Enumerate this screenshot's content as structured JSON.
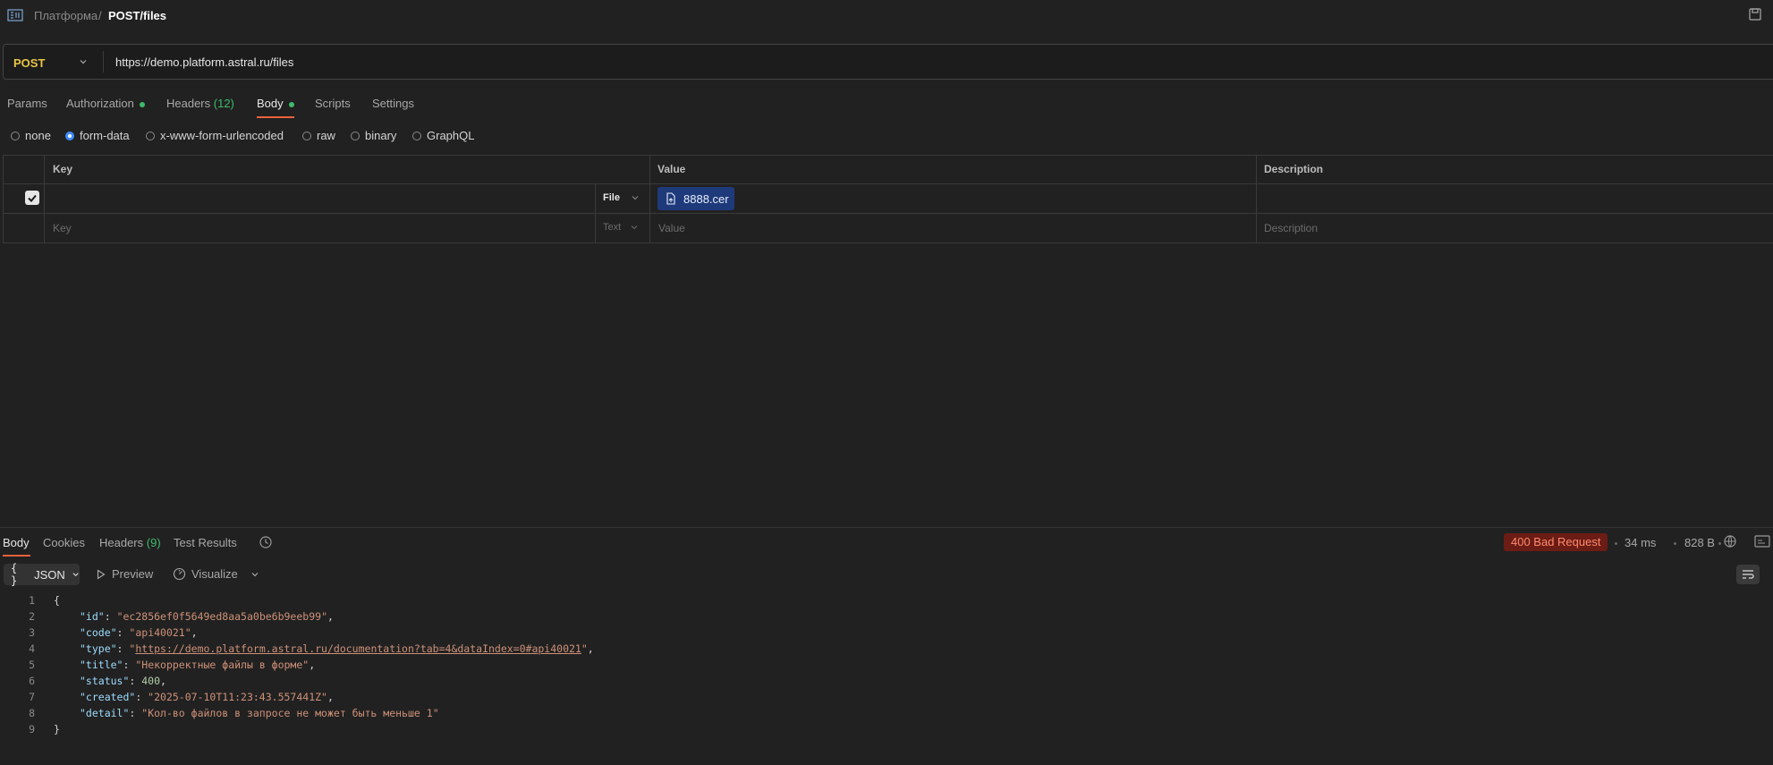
{
  "breadcrumb": {
    "parent": "Платформа",
    "separator": "/",
    "current": "POST/files"
  },
  "request": {
    "method": "POST",
    "url": "https://demo.platform.astral.ru/files"
  },
  "request_tabs": [
    {
      "label": "Params"
    },
    {
      "label": "Authorization"
    },
    {
      "label": "Headers",
      "count": "(12)"
    },
    {
      "label": "Body"
    },
    {
      "label": "Scripts"
    },
    {
      "label": "Settings"
    }
  ],
  "body_types": [
    "none",
    "form-data",
    "x-www-form-urlencoded",
    "raw",
    "binary",
    "GraphQL"
  ],
  "body_type_selected": "form-data",
  "form_table": {
    "headers": [
      "Key",
      "Value",
      "Description"
    ],
    "rows": [
      {
        "checked": true,
        "key": "",
        "type": "File",
        "value": "8888.cer",
        "description": ""
      }
    ],
    "new_row": {
      "key_placeholder": "Key",
      "type": "Text",
      "value_placeholder": "Value",
      "description_placeholder": "Description"
    }
  },
  "response_tabs": [
    {
      "label": "Body"
    },
    {
      "label": "Cookies"
    },
    {
      "label": "Headers",
      "count": "(9)"
    },
    {
      "label": "Test Results"
    }
  ],
  "response_meta": {
    "status": "400 Bad Request",
    "time": "34 ms",
    "size": "828 B"
  },
  "response_toolbar": {
    "format": "JSON",
    "preview": "Preview",
    "visualize": "Visualize"
  },
  "response_json": {
    "id": "ec2856ef0f5649ed8aa5a0be6b9eeb99",
    "code": "api40021",
    "type": "https://demo.platform.astral.ru/documentation?tab=4&dataIndex=0#api40021",
    "title": "Некорректные файлы в форме",
    "status": "400",
    "created": "2025-07-10T11:23:43.557441Z",
    "detail": "Кол-во файлов в запросе не может быть меньше 1"
  },
  "line_numbers": [
    "1",
    "2",
    "3",
    "4",
    "5",
    "6",
    "7",
    "8",
    "9"
  ],
  "colors": {
    "accent": "#e8623c",
    "status_error": "#6b1c14",
    "method": "#e8c547",
    "green": "#3dbb6a",
    "file_pill": "#1e3a7a"
  }
}
